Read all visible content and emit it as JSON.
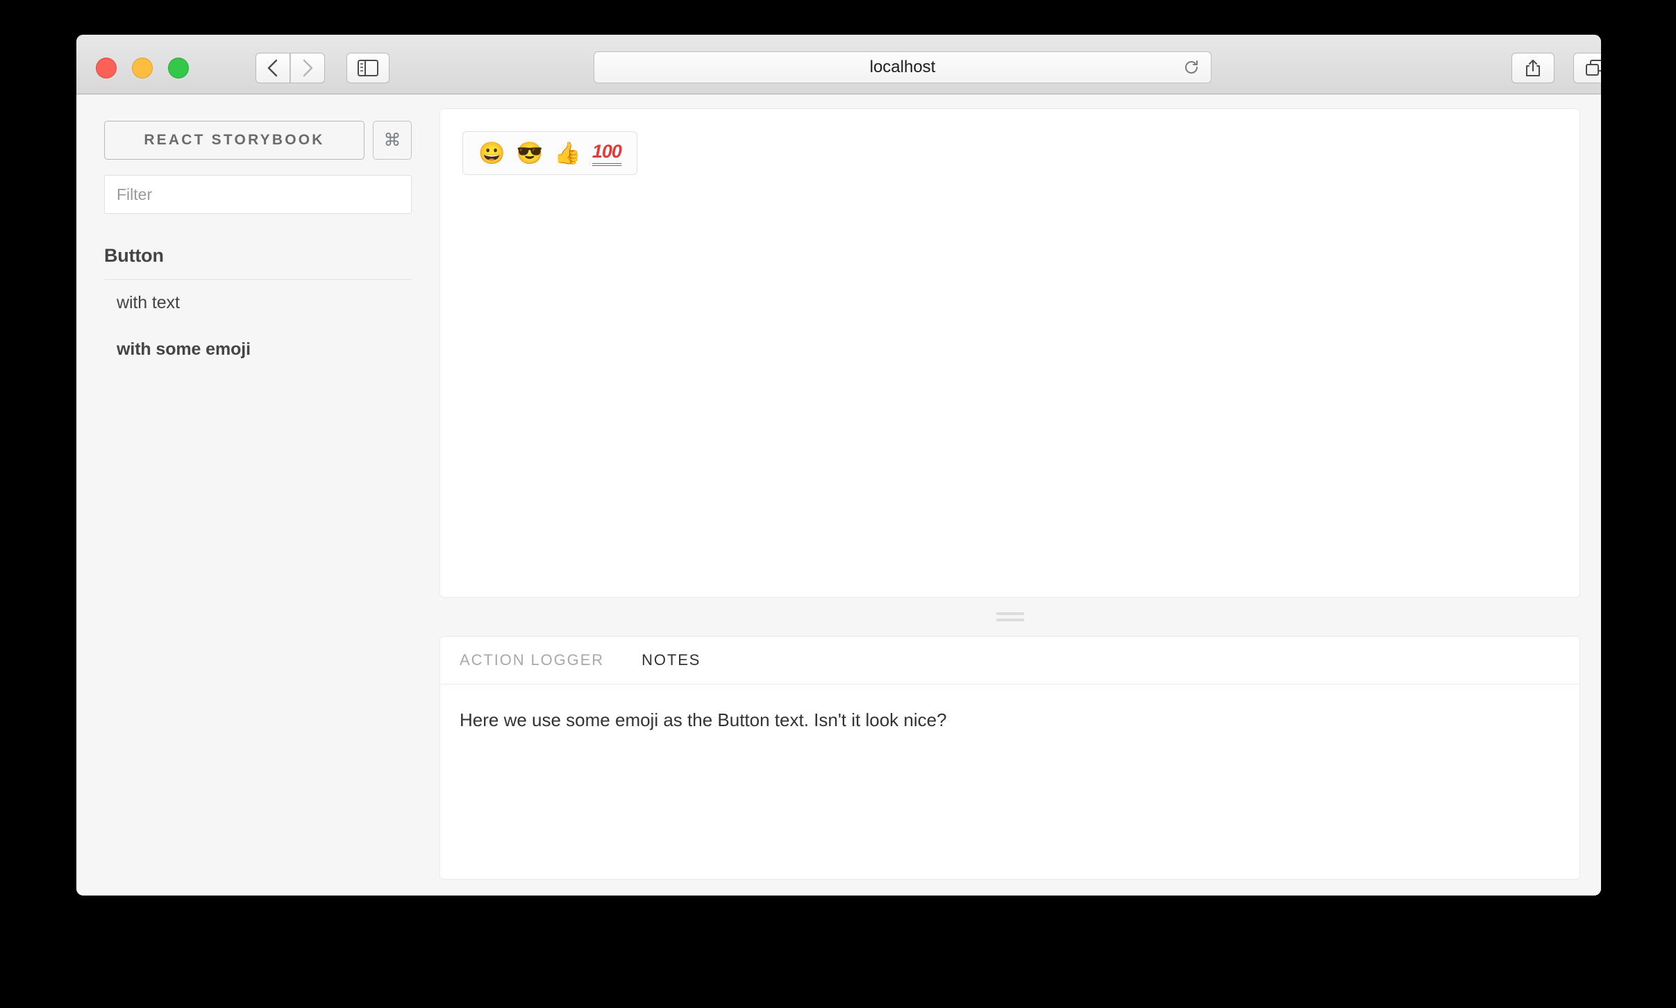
{
  "browser": {
    "url": "localhost",
    "traffic_lights": [
      "close",
      "minimize",
      "zoom"
    ],
    "back_icon": "chevron-left-icon",
    "forward_icon": "chevron-right-icon",
    "sidebar_icon": "sidebar-toggle-icon",
    "reload_icon": "reload-icon",
    "share_icon": "share-icon",
    "tabs_icon": "show-all-tabs-icon",
    "new_tab_label": "+"
  },
  "sidebar": {
    "title": "REACT STORYBOOK",
    "shortcut_icon": "command-key-icon",
    "shortcut_glyph": "⌘",
    "filter_placeholder": "Filter",
    "filter_value": "",
    "kinds": [
      {
        "name": "Button",
        "stories": [
          {
            "label": "with text",
            "selected": false
          },
          {
            "label": "with some emoji",
            "selected": true
          }
        ]
      }
    ]
  },
  "preview": {
    "button": {
      "emojis": [
        "😀",
        "😎",
        "👍"
      ],
      "hundred_label": "100"
    }
  },
  "bottom_panel": {
    "tabs": [
      {
        "label": "ACTION LOGGER",
        "active": false
      },
      {
        "label": "NOTES",
        "active": true
      }
    ],
    "notes_text": "Here we use some emoji as the Button text. Isn't it look nice?"
  },
  "colors": {
    "window_chrome": "#d9d8d9",
    "app_background": "#f6f6f6",
    "panel_background": "#ffffff",
    "text_primary": "#333333",
    "text_muted": "#a9a9a9",
    "accent_red": "#e03b3b"
  }
}
